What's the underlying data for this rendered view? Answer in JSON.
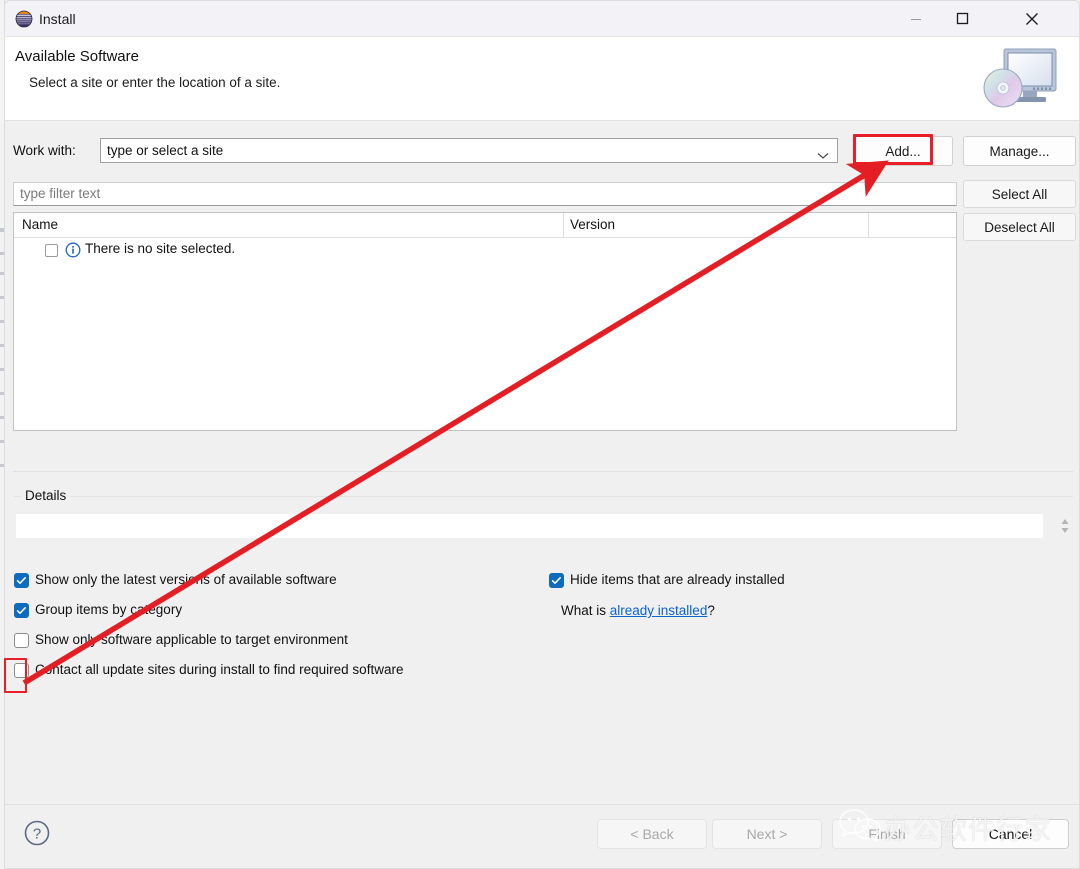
{
  "window": {
    "title": "Install",
    "icon": "eclipse-icon",
    "minimize_label": "Minimize",
    "maximize_label": "Maximize",
    "close_label": "Close"
  },
  "header": {
    "title": "Available Software",
    "subtitle": "Select a site or enter the location of a site.",
    "art": "monitor-with-disc-icon"
  },
  "work_with": {
    "label": "Work with:",
    "value": "type or select a site",
    "placeholder": "type or select a site",
    "add_label": "Add...",
    "manage_label": "Manage..."
  },
  "filter": {
    "placeholder": "type filter text",
    "value": ""
  },
  "list_actions": {
    "select_all": "Select All",
    "deselect_all": "Deselect All"
  },
  "tree": {
    "columns": [
      "Name",
      "Version"
    ],
    "rows": [
      {
        "checked": false,
        "icon": "info-icon",
        "name": "There is no site selected.",
        "version": ""
      }
    ]
  },
  "details": {
    "legend": "Details",
    "value": ""
  },
  "options_left": [
    {
      "label": "Show only the latest versions of available software",
      "checked": true
    },
    {
      "label": "Group items by category",
      "checked": true
    },
    {
      "label": "Show only software applicable to target environment",
      "checked": false
    },
    {
      "label": "Contact all update sites during install to find required software",
      "checked": false
    }
  ],
  "options_right": [
    {
      "label": "Hide items that are already installed",
      "checked": true
    }
  ],
  "already_installed": {
    "prefix": "What is ",
    "link": "already installed",
    "suffix": "?"
  },
  "footer": {
    "help_label": "?",
    "back": "< Back",
    "next": "Next >",
    "finish": "Finish",
    "cancel": "Cancel"
  },
  "annotations": {
    "highlight_color": "#e81f26",
    "arrow_from": "contact-all-update-sites-checkbox",
    "arrow_to": "add-button"
  },
  "watermark": {
    "text": "办公软件行家",
    "logo": "wechat-icon"
  }
}
